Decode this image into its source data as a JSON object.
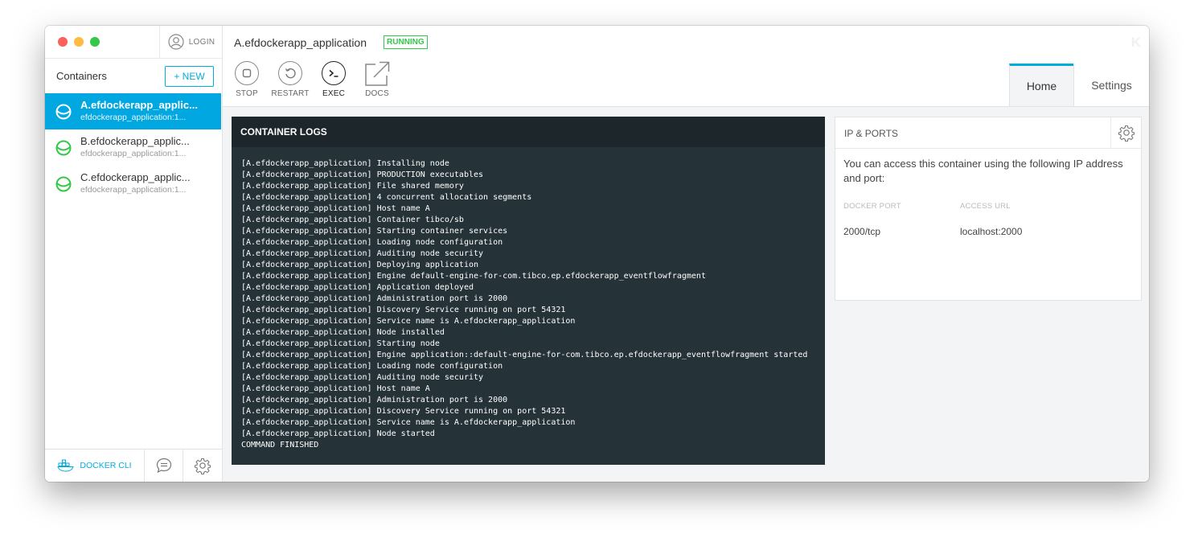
{
  "window": {
    "controls": [
      "close",
      "minimize",
      "maximize"
    ]
  },
  "sidebar": {
    "login_label": "LOGIN",
    "title": "Containers",
    "new_label": "+ NEW",
    "containers": [
      {
        "name": "A.efdockerapp_applic...",
        "image": "efdockerapp_application:1...",
        "active": true
      },
      {
        "name": "B.efdockerapp_applic...",
        "image": "efdockerapp_application:1...",
        "active": false
      },
      {
        "name": "C.efdockerapp_applic...",
        "image": "efdockerapp_application:1...",
        "active": false
      }
    ],
    "footer": {
      "docker_cli_label": "DOCKER CLI"
    }
  },
  "header": {
    "title": "A.efdockerapp_application",
    "status": "RUNNING",
    "logo": "K",
    "toolbar": [
      {
        "label": "STOP",
        "icon": "stop-icon"
      },
      {
        "label": "RESTART",
        "icon": "restart-icon"
      },
      {
        "label": "EXEC",
        "icon": "terminal-icon"
      },
      {
        "label": "DOCS",
        "icon": "external-link-icon"
      }
    ],
    "tabs": [
      {
        "label": "Home",
        "active": true
      },
      {
        "label": "Settings",
        "active": false
      }
    ]
  },
  "logs": {
    "title": "CONTAINER LOGS",
    "lines": [
      "[A.efdockerapp_application] Installing node",
      "[A.efdockerapp_application] PRODUCTION executables",
      "[A.efdockerapp_application] File shared memory",
      "[A.efdockerapp_application] 4 concurrent allocation segments",
      "[A.efdockerapp_application] Host name A",
      "[A.efdockerapp_application] Container tibco/sb",
      "[A.efdockerapp_application] Starting container services",
      "[A.efdockerapp_application] Loading node configuration",
      "[A.efdockerapp_application] Auditing node security",
      "[A.efdockerapp_application] Deploying application",
      "[A.efdockerapp_application] Engine default-engine-for-com.tibco.ep.efdockerapp_eventflowfragment",
      "[A.efdockerapp_application] Application deployed",
      "[A.efdockerapp_application] Administration port is 2000",
      "[A.efdockerapp_application] Discovery Service running on port 54321",
      "[A.efdockerapp_application] Service name is A.efdockerapp_application",
      "[A.efdockerapp_application] Node installed",
      "[A.efdockerapp_application] Starting node",
      "[A.efdockerapp_application] Engine application::default-engine-for-com.tibco.ep.efdockerapp_eventflowfragment started",
      "[A.efdockerapp_application] Loading node configuration",
      "[A.efdockerapp_application] Auditing node security",
      "[A.efdockerapp_application] Host name A",
      "[A.efdockerapp_application] Administration port is 2000",
      "[A.efdockerapp_application] Discovery Service running on port 54321",
      "[A.efdockerapp_application] Service name is A.efdockerapp_application",
      "[A.efdockerapp_application] Node started",
      "COMMAND FINISHED"
    ]
  },
  "ip_ports": {
    "title": "IP & PORTS",
    "description": "You can access this container using the following IP address and port:",
    "col_docker_port": "DOCKER PORT",
    "col_access_url": "ACCESS URL",
    "docker_port": "2000/tcp",
    "access_url": "localhost:2000"
  },
  "colors": {
    "accent": "#00aede",
    "running": "#34c84a",
    "log_bg": "#253238"
  }
}
